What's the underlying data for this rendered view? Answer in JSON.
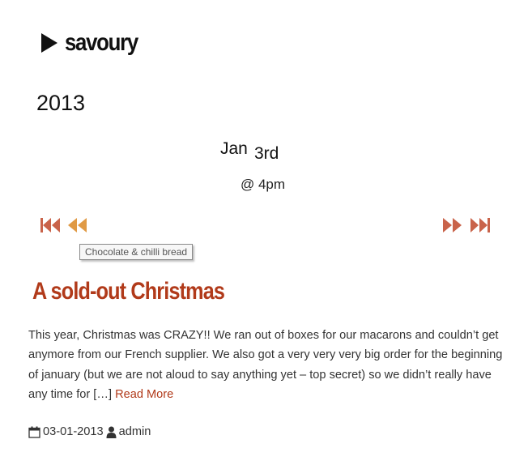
{
  "category": {
    "icon": "play-icon",
    "title": "savoury"
  },
  "archive": {
    "year": "2013",
    "month": "Jan",
    "day": "3rd",
    "time": "@ 4pm"
  },
  "navigation": {
    "first_icon": "skip-first-icon",
    "prev_icon": "rewind-icon",
    "next_icon": "fast-forward-icon",
    "last_icon": "skip-last-icon",
    "tooltip": "Chocolate & chilli bread"
  },
  "post": {
    "title": "A sold-out Christmas",
    "excerpt": "This year, Christmas was CRAZY!! We ran out of boxes for our macarons and couldn’t get anymore from our French supplier. We also got a very very very big order for the beginning of january (but we are not aloud to say anything yet – top secret) so we didn’t really have any time for […]",
    "read_more": "Read More",
    "date": "03-01-2013",
    "date_icon": "calendar-icon",
    "author": "admin",
    "author_icon": "user-icon"
  },
  "colors": {
    "accent": "#b13a1a",
    "nav_first_last": "#c9634a",
    "nav_prev_next": "#e09a45",
    "text": "#333333"
  }
}
